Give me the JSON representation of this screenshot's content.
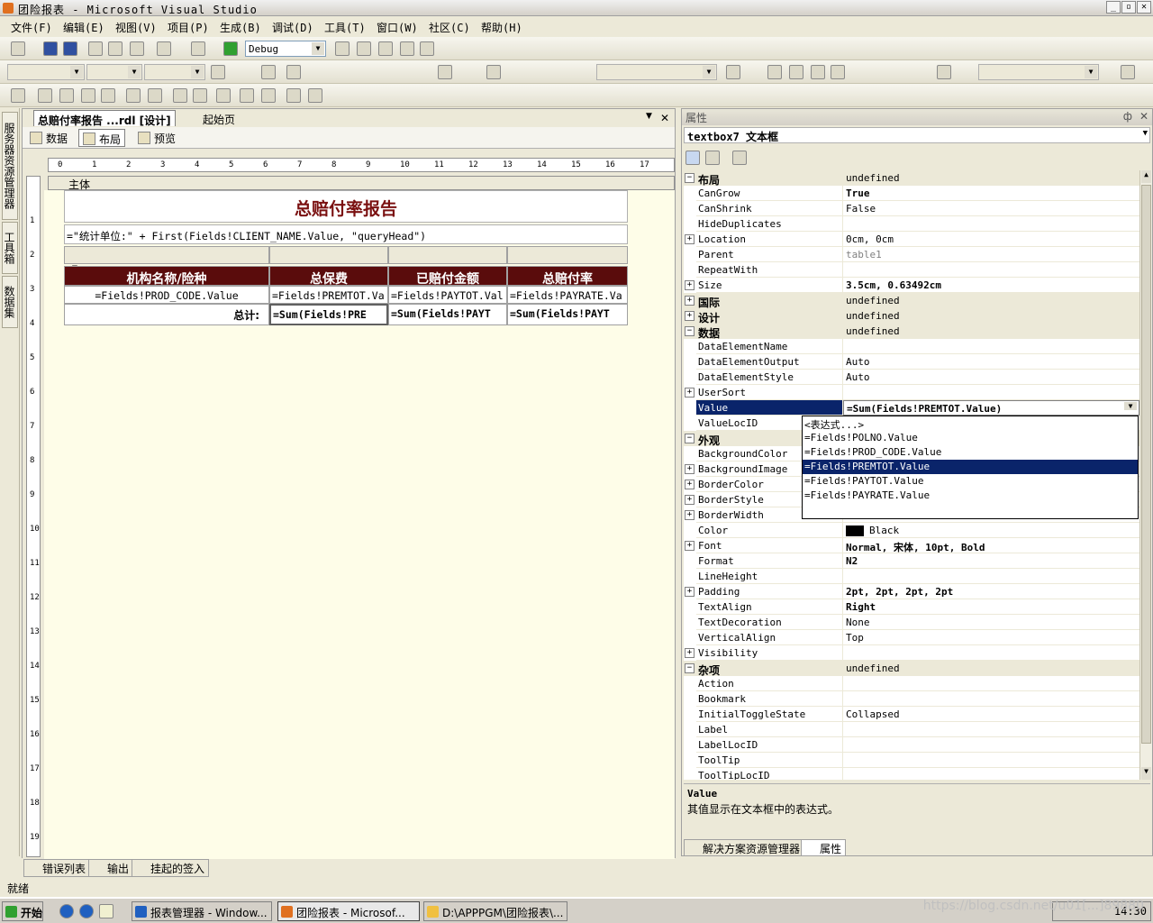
{
  "window": {
    "title": "团险报表 - Microsoft Visual Studio",
    "min": "_",
    "max": "▫",
    "close": "✕"
  },
  "menu": [
    "文件(F)",
    "编辑(E)",
    "视图(V)",
    "项目(P)",
    "生成(B)",
    "调试(D)",
    "工具(T)",
    "窗口(W)",
    "社区(C)",
    "帮助(H)"
  ],
  "toolbar": {
    "config": "Debug"
  },
  "left_tabs": [
    "服务器资源管理器",
    "工具箱",
    "数据集"
  ],
  "doc": {
    "tab_active": "总赔付率报告 ...rdl [设计]",
    "tab_other": "起始页",
    "close": "✕",
    "pin": "▼",
    "subtabs": [
      "数据",
      "布局",
      "预览"
    ],
    "body_label": "主体",
    "ruler_h": [
      "0",
      "1",
      "2",
      "3",
      "4",
      "5",
      "6",
      "7",
      "8",
      "9",
      "10",
      "11",
      "12",
      "13",
      "14",
      "15",
      "16",
      "17"
    ],
    "ruler_v": [
      "1",
      "2",
      "3",
      "4",
      "5",
      "6",
      "7",
      "8",
      "9",
      "10",
      "11",
      "12",
      "13",
      "14",
      "15",
      "16",
      "17",
      "18",
      "19"
    ],
    "report_title": "总赔付率报告",
    "unit_expr": "=\"统计单位:\" + First(Fields!CLIENT_NAME.Value, \"queryHead\")",
    "headers": [
      "机构名称/险种",
      "总保费",
      "已赔付金额",
      "总赔付率"
    ],
    "detail": [
      "=Fields!PROD_CODE.Value",
      "=Fields!PREMTOT.Va",
      "=Fields!PAYTOT.Val",
      "=Fields!PAYRATE.Va"
    ],
    "footer_label": "总计:",
    "footer": [
      "=Sum(Fields!PRE",
      "=Sum(Fields!PAYT",
      "=Sum(Fields!PAYT"
    ]
  },
  "props": {
    "header": "属性",
    "pin": "ф",
    "close": "✕",
    "object": "textbox7 文本框",
    "rows": [
      {
        "t": "cat",
        "n": "布局",
        "e": "⊟"
      },
      {
        "n": "CanGrow",
        "v": "True",
        "b": true
      },
      {
        "n": "CanShrink",
        "v": "False"
      },
      {
        "n": "HideDuplicates",
        "v": ""
      },
      {
        "n": "Location",
        "v": "0cm, 0cm",
        "e": "+"
      },
      {
        "n": "Parent",
        "v": "table1",
        "g": true
      },
      {
        "n": "RepeatWith",
        "v": ""
      },
      {
        "n": "Size",
        "v": "3.5cm, 0.63492cm",
        "e": "+",
        "b": true
      },
      {
        "t": "cat",
        "n": "国际",
        "e": "+"
      },
      {
        "t": "cat",
        "n": "设计",
        "e": "+"
      },
      {
        "t": "cat",
        "n": "数据",
        "e": "⊟"
      },
      {
        "n": "DataElementName",
        "v": ""
      },
      {
        "n": "DataElementOutput",
        "v": "Auto"
      },
      {
        "n": "DataElementStyle",
        "v": "Auto"
      },
      {
        "n": "UserSort",
        "v": "",
        "e": "+"
      },
      {
        "n": "Value",
        "v": "=Sum(Fields!PREMTOT.Value)",
        "s": true,
        "b": true
      },
      {
        "n": "ValueLocID",
        "v": ""
      },
      {
        "t": "cat",
        "n": "外观",
        "e": "⊟"
      },
      {
        "n": "BackgroundColor",
        "v": ""
      },
      {
        "n": "BackgroundImage",
        "v": "",
        "e": "+"
      },
      {
        "n": "BorderColor",
        "v": "",
        "e": "+"
      },
      {
        "n": "BorderStyle",
        "v": "",
        "e": "+"
      },
      {
        "n": "BorderWidth",
        "v": "",
        "e": "+"
      },
      {
        "n": "Color",
        "v": "Black",
        "sw": true
      },
      {
        "n": "Font",
        "v": "Normal, 宋体, 10pt, Bold",
        "e": "+",
        "b": true
      },
      {
        "n": "Format",
        "v": "N2",
        "b": true
      },
      {
        "n": "LineHeight",
        "v": ""
      },
      {
        "n": "Padding",
        "v": "2pt, 2pt, 2pt, 2pt",
        "e": "+",
        "b": true
      },
      {
        "n": "TextAlign",
        "v": "Right",
        "b": true
      },
      {
        "n": "TextDecoration",
        "v": "None"
      },
      {
        "n": "VerticalAlign",
        "v": "Top"
      },
      {
        "n": "Visibility",
        "v": "",
        "e": "+"
      },
      {
        "t": "cat",
        "n": "杂项",
        "e": "⊟"
      },
      {
        "n": "Action",
        "v": ""
      },
      {
        "n": "Bookmark",
        "v": ""
      },
      {
        "n": "InitialToggleState",
        "v": "Collapsed"
      },
      {
        "n": "Label",
        "v": ""
      },
      {
        "n": "LabelLocID",
        "v": ""
      },
      {
        "n": "ToolTip",
        "v": ""
      },
      {
        "n": "ToolTipLocID",
        "v": ""
      }
    ],
    "dropdown": [
      "<表达式...>",
      "=Fields!POLNO.Value",
      "=Fields!PROD_CODE.Value",
      "=Fields!PREMTOT.Value",
      "=Fields!PAYTOT.Value",
      "=Fields!PAYRATE.Value"
    ],
    "dropdown_selected": 3,
    "desc_name": "Value",
    "desc_text": "其值显示在文本框中的表达式。",
    "tabs": [
      "解决方案资源管理器",
      "属性"
    ]
  },
  "bottom_tabs": [
    "错误列表",
    "输出",
    "挂起的签入"
  ],
  "status": "就绪",
  "taskbar": {
    "start": "开始",
    "items": [
      "报表管理器 - Window...",
      "团险报表 - Microsof...",
      "D:\\APPPGM\\团险报表\\..."
    ],
    "time": "14:30"
  },
  "watermark": "https://blog.csdn.net/u01[...]89880"
}
